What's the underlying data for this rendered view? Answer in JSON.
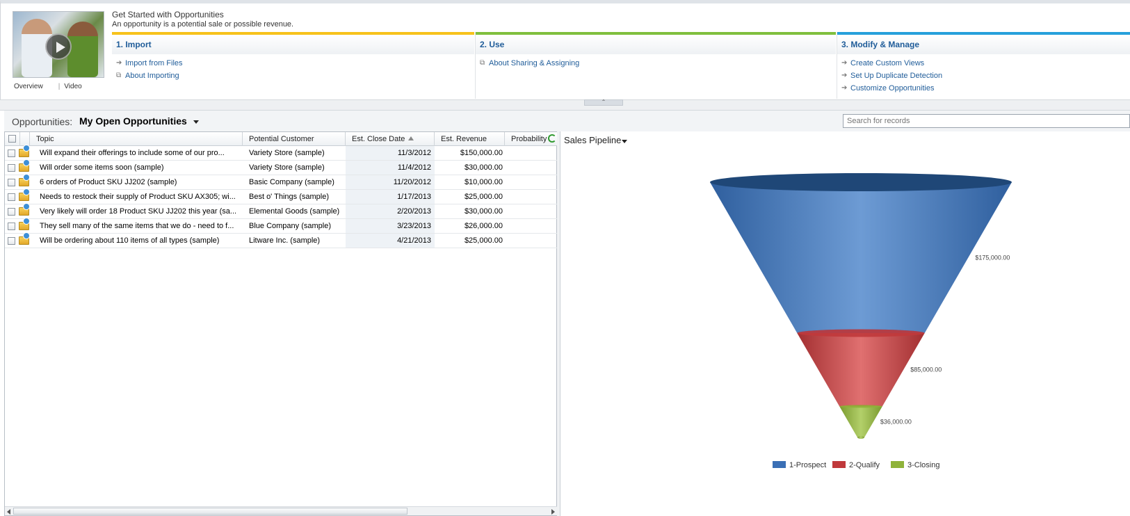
{
  "get_started": {
    "title": "Get Started with Opportunities",
    "subtitle": "An opportunity is a potential sale or possible revenue.",
    "thumb_links": [
      "Overview",
      "Video"
    ],
    "columns": [
      {
        "heading": "1. Import",
        "color": "#f7c21b",
        "links": [
          {
            "icon": "arrow-right-icon",
            "label": "Import from Files"
          },
          {
            "icon": "popout-icon",
            "label": "About Importing"
          }
        ]
      },
      {
        "heading": "2. Use",
        "color": "#7fbf3d",
        "links": [
          {
            "icon": "popout-icon",
            "label": "About Sharing & Assigning"
          }
        ]
      },
      {
        "heading": "3. Modify & Manage",
        "color": "#25a0db",
        "links": [
          {
            "icon": "arrow-right-icon",
            "label": "Create Custom Views"
          },
          {
            "icon": "arrow-right-icon",
            "label": "Set Up Duplicate Detection"
          },
          {
            "icon": "arrow-right-icon",
            "label": "Customize Opportunities"
          }
        ]
      }
    ]
  },
  "view": {
    "label": "Opportunities:",
    "name": "My Open Opportunities",
    "search_placeholder": "Search for records"
  },
  "grid": {
    "columns": [
      "Topic",
      "Potential Customer",
      "Est. Close Date",
      "Est. Revenue",
      "Probability"
    ],
    "rows": [
      {
        "topic": "Will expand their offerings to include some of our pro...",
        "customer": "Variety Store (sample)",
        "close": "11/3/2012",
        "revenue": "$150,000.00"
      },
      {
        "topic": "Will order some items soon (sample)",
        "customer": "Variety Store (sample)",
        "close": "11/4/2012",
        "revenue": "$30,000.00"
      },
      {
        "topic": "6 orders of Product SKU JJ202 (sample)",
        "customer": "Basic Company (sample)",
        "close": "11/20/2012",
        "revenue": "$10,000.00"
      },
      {
        "topic": "Needs to restock their supply of Product SKU AX305; wi...",
        "customer": "Best o' Things (sample)",
        "close": "1/17/2013",
        "revenue": "$25,000.00"
      },
      {
        "topic": "Very likely will order 18 Product SKU JJ202 this year (sa...",
        "customer": "Elemental Goods (sample)",
        "close": "2/20/2013",
        "revenue": "$30,000.00"
      },
      {
        "topic": "They sell many of the same items that we do - need to f...",
        "customer": "Blue Company (sample)",
        "close": "3/23/2013",
        "revenue": "$26,000.00"
      },
      {
        "topic": "Will be ordering about 110 items of all types (sample)",
        "customer": "Litware Inc. (sample)",
        "close": "4/21/2013",
        "revenue": "$25,000.00"
      }
    ]
  },
  "chart": {
    "title": "Sales Pipeline"
  },
  "chart_data": {
    "type": "funnel",
    "title": "Sales Pipeline",
    "categories": [
      "1-Prospect",
      "2-Qualify",
      "3-Closing"
    ],
    "values": [
      175000,
      85000,
      36000
    ],
    "value_labels": [
      "$175,000.00",
      "$85,000.00",
      "$36,000.00"
    ],
    "colors": [
      "#3a6fb5",
      "#c0393b",
      "#8fb33a"
    ],
    "legend": "bottom-center"
  }
}
